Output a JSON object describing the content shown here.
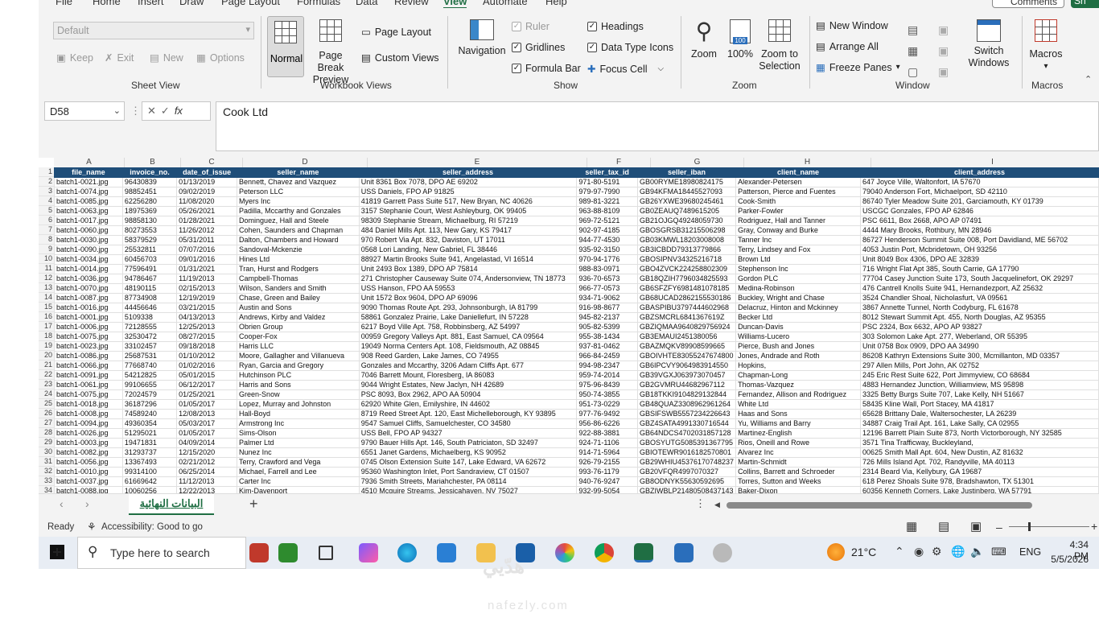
{
  "ribbon_tabs": [
    "File",
    "Home",
    "Insert",
    "Draw",
    "Page Layout",
    "Formulas",
    "Data",
    "Review",
    "View",
    "Automate",
    "Help"
  ],
  "active_tab": "View",
  "comments_label": "Comments",
  "share_label": "Sh",
  "sheet_view": {
    "select_value": "Default",
    "keep": "Keep",
    "exit": "Exit",
    "new": "New",
    "options": "Options",
    "group_label": "Sheet View"
  },
  "workbook_views": {
    "normal": "Normal",
    "page_break": "Page Break Preview",
    "page_layout": "Page Layout",
    "custom_views": "Custom Views",
    "group_label": "Workbook Views"
  },
  "show": {
    "navigation": "Navigation",
    "ruler": "Ruler",
    "gridlines": "Gridlines",
    "formula_bar": "Formula Bar",
    "headings": "Headings",
    "data_type_icons": "Data Type Icons",
    "focus_cell": "Focus Cell",
    "group_label": "Show"
  },
  "zoom": {
    "zoom": "Zoom",
    "hundred": "100%",
    "zoom_selection": "Zoom to Selection",
    "group_label": "Zoom"
  },
  "window": {
    "new_window": "New Window",
    "arrange_all": "Arrange All",
    "freeze_panes": "Freeze Panes",
    "switch_windows": "Switch Windows",
    "group_label": "Window"
  },
  "macros": {
    "macros": "Macros",
    "group_label": "Macros"
  },
  "formula_bar": {
    "name_box": "D58",
    "formula": "Cook Ltd",
    "fx": "fx"
  },
  "columns": [
    "A",
    "B",
    "C",
    "D",
    "E",
    "F",
    "G",
    "H",
    "I"
  ],
  "headers": [
    "file_name",
    "invoice_no.",
    "date_of_issue",
    "seller_name",
    "seller_address",
    "seller_tax_id",
    "seller_iban",
    "client_name",
    "client_address"
  ],
  "rows": [
    [
      "batch1-0021.jpg",
      "96430839",
      "01/13/2019",
      "Bennett, Chavez and Vazquez",
      "Unit 8361 Box 7078, DPO AE 69202",
      "971-80-5191",
      "GB00RYME18980824175",
      "Alexander-Petersen",
      "647 Joyce Ville, Waltonfort, IA 57670"
    ],
    [
      "batch1-0074.jpg",
      "98852451",
      "09/02/2019",
      "Peterson LLC",
      "USS Daniels, FPO AP 91825",
      "979-97-7990",
      "GB94KFMA18445527093",
      "Patterson, Pierce and Fuentes",
      "79040 Anderson Fort, Michaelport, SD 42110"
    ],
    [
      "batch1-0085.jpg",
      "62256280",
      "11/08/2020",
      "Myers Inc",
      "41819 Garrett Pass Suite 517, New Bryan, NC 40626",
      "989-81-3221",
      "GB26YXWE39680245461",
      "Cook-Smith",
      "86740 Tyler Meadow Suite 201, Garciamouth, KY 01739"
    ],
    [
      "batch1-0063.jpg",
      "18975369",
      "05/26/2021",
      "Padilla, Mccarthy and Gonzales",
      "3157 Stephanie Court, West Ashleyburg, OK 99405",
      "963-88-8109",
      "GB0ZEAUQ7489615205",
      "Parker-Fowler",
      "USCGC Gonzales, FPO AP 62846"
    ],
    [
      "batch1-0017.jpg",
      "98858130",
      "01/28/2021",
      "Dominguez, Hall and Steele",
      "98309 Stephanie Stream, Michaelburg, RI 57219",
      "969-72-5121",
      "GB21OJGQ49248059730",
      "Rodriguez, Hall and Tanner",
      "PSC 6611, Box 2668, APO AP 07491"
    ],
    [
      "batch1-0060.jpg",
      "80273553",
      "11/26/2012",
      "Cohen, Saunders and Chapman",
      "484 Daniel Mills Apt. 113, New Gary, KS 79417",
      "902-97-4185",
      "GBOSGRSB31215506298",
      "Gray, Conway and Burke",
      "4444 Mary Brooks, Rothbury, MN 28946"
    ],
    [
      "batch1-0030.jpg",
      "58379529",
      "05/31/2011",
      "Dalton, Chambers and Howard",
      "970 Robert Via Apt. 832, Daviston, UT 17011",
      "944-77-4530",
      "GB03KMWL18203008008",
      "Tanner Inc",
      "86727 Henderson Summit Suite 008, Port Davidland, ME 56702"
    ],
    [
      "batch1-0090.jpg",
      "25532811",
      "07/07/2016",
      "Sandoval-Mckenzie",
      "0568 Lori Landing, New Gabriel, FL 38446",
      "935-92-3150",
      "GB3ICBDD79313779866",
      "Terry, Lindsey and Fox",
      "4053 Justin Port, Mcbridetown, OH 93256"
    ],
    [
      "batch1-0034.jpg",
      "60456703",
      "09/01/2016",
      "Hines Ltd",
      "88927 Martin Brooks Suite 941, Angelastad, VI 16514",
      "970-94-1776",
      "GBOSIPNV34325216718",
      "Brown Ltd",
      "Unit 8049 Box 4306, DPO AE 32839"
    ],
    [
      "batch1-0014.jpg",
      "77596491",
      "01/31/2021",
      "Tran, Hurst and Rodgers",
      "Unit 2493 Box 1389, DPO AP 75814",
      "988-83-0971",
      "GBO4ZVCK224258802309",
      "Stephenson Inc",
      "716 Wright Flat Apt 385, South Carrie, GA 17790"
    ],
    [
      "batch1-0036.jpg",
      "94786467",
      "11/19/2013",
      "Campbell-Thomas",
      "271 Christopher Causeway Suite 074, Andersonview, TN 18773",
      "936-70-6573",
      "GB18QZIH7796034825593",
      "Gordon PLC",
      "77704 Casey Junction Suite 173, South Jacquelinefort, OK 29297"
    ],
    [
      "batch1-0070.jpg",
      "48190115",
      "02/15/2013",
      "Wilson, Sanders and Smith",
      "USS Hanson, FPO AA 59553",
      "966-77-0573",
      "GB6SFZFY6981481078185",
      "Medina-Robinson",
      "476 Cantrell Knolls Suite 941, Hernandezport, AZ 25632"
    ],
    [
      "batch1-0087.jpg",
      "87734908",
      "12/19/2019",
      "Chase, Green and Bailey",
      "Unit 1572 Box 9604, DPO AP 69096",
      "934-71-9062",
      "GB68UCAD2862155530186",
      "Buckley, Wright and Chase",
      "3524 Chandler Shoal, Nicholasfurt, VA 09561"
    ],
    [
      "batch1-0016.jpg",
      "44456646",
      "03/21/2015",
      "Austin and Sons",
      "9090 Thomas Route Apt. 293, Johnsonburgh, IA 81799",
      "916-98-8677",
      "GBASPIBU3797444602968",
      "Delacruz, Hinton and Mckinney",
      "3867 Annette Tunnel, North Codyburg, FL 61678"
    ],
    [
      "batch1-0001.jpg",
      "5109338",
      "04/13/2013",
      "Andrews, Kirby and Valdez",
      "58861 Gonzalez Prairie, Lake Daniellefurt, IN 57228",
      "945-82-2137",
      "GBZSMCRL6841367619Z",
      "Becker Ltd",
      "8012 Stewart Summit Apt. 455, North Douglas, AZ 95355"
    ],
    [
      "batch1-0006.jpg",
      "72128555",
      "12/25/2013",
      "Obrien Group",
      "6217 Boyd Ville Apt. 758, Robbinsberg, AZ 54997",
      "905-82-5399",
      "GBZIQMAA9640829756924",
      "Duncan-Davis",
      "PSC 2324, Box 6632, APO AP 93827"
    ],
    [
      "batch1-0075.jpg",
      "32530472",
      "08/27/2015",
      "Cooper-Fox",
      "00959 Gregory Valleys Apt. 881, East Samuel, CA 09564",
      "955-38-1434",
      "GB3EMAUI2451380056",
      "Williams-Lucero",
      "303 Solomon Lake Apt. 277, Weberland, OR 55395"
    ],
    [
      "batch1-0023.jpg",
      "33102457",
      "09/18/2018",
      "Harris LLC",
      "19049 Norma Centers Apt. 108, Fieldsmouth, AZ 08845",
      "937-81-0462",
      "GBAZMQKV89908599665",
      "Pierce, Bush and Jones",
      "Unit 0758 Box 0909, DPO AA 34990"
    ],
    [
      "batch1-0086.jpg",
      "25687531",
      "01/10/2012",
      "Moore, Gallagher and Villanueva",
      "908 Reed Garden, Lake James, CO 74955",
      "966-84-2459",
      "GBOIVHTE83055247674800",
      "Jones, Andrade and Roth",
      "86208 Kathryn Extensions Suite 300, Mcmillanton, MD 03357"
    ],
    [
      "batch1-0066.jpg",
      "77668740",
      "01/02/2016",
      "Ryan, Garcia and Gregory",
      "Gonzales and Mccarthy, 3206 Adam Cliffs Apt. 677",
      "994-98-2347",
      "GB6IPCVY9064983914550",
      "Hopkins,",
      "297 Allen Mills, Port John, AK 02752"
    ],
    [
      "batch1-0091.jpg",
      "54212825",
      "05/01/2015",
      "Hutchinson PLC",
      "7046 Barrett Mount, Floresberg, IA 86083",
      "959-74-2014",
      "GB39VGXJ063973070457",
      "Chapman-Long",
      "245 Eric Rest Suite 622, Port Jimmyview, CO 68684"
    ],
    [
      "batch1-0061.jpg",
      "99106655",
      "06/12/2017",
      "Harris and Sons",
      "9044 Wright Estates, New Jaclyn, NH 42689",
      "975-96-8439",
      "GB2GVMRU44682967112",
      "Thomas-Vazquez",
      "4883 Hernandez Junction, Williamview, MS 95898"
    ],
    [
      "batch1-0075.jpg",
      "72024579",
      "01/25/2021",
      "Green-Snow",
      "PSC 8093, Box 2962, APO AA 50904",
      "950-74-3855",
      "GB18TKKI9104829132844",
      "Fernandez, Allison and Rodriguez",
      "3325 Betty Burgs Suite 707, Lake Kelly, NH 51667"
    ],
    [
      "batch1-0018.jpg",
      "36187296",
      "01/05/2017",
      "Lopez, Murray and Johnston",
      "62920 White Glen, Emilyshire, IN 44602",
      "951-73-0229",
      "GB48QUAZ3308962961264",
      "White Ltd",
      "58435 Kline Wall, Port Stacey, MA 41817"
    ],
    [
      "batch1-0008.jpg",
      "74589240",
      "12/08/2013",
      "Hall-Boyd",
      "8719 Reed Street Apt. 120, East Michelleborough, KY 93895",
      "977-76-9492",
      "GBSIFSWB5557234226643",
      "Haas and Sons",
      "65628 Brittany Dale, Waltersochester, LA 26239"
    ],
    [
      "batch1-0094.jpg",
      "49360354",
      "05/03/2017",
      "Armstrong Inc",
      "9547 Samuel Cliffs, Samuelchester, CO 34580",
      "956-86-6226",
      "GBZ4SATA4991330716544",
      "Yu, Williams and Barry",
      "34887 Craig Trail Apt. 161, Lake Sally, CA 02955"
    ],
    [
      "batch1-0026.jpg",
      "51295021",
      "01/05/2017",
      "Sims-Olson",
      "USS Bell, FPO AP 94327",
      "922-88-3881",
      "GB64NDCS4702031857128",
      "Martinez-English",
      "12196 Barrett Plain Suite 873, North Victorborough, NY 32585"
    ],
    [
      "batch1-0003.jpg",
      "19471831",
      "04/09/2014",
      "Palmer Ltd",
      "9790 Bauer Hills Apt. 146, South Patriciaton, SD 32497",
      "924-71-1106",
      "GBOSYUTG5085391367795",
      "Rios, Oneill and Rowe",
      "3571 Tina Trafficway, Buckleyland,"
    ],
    [
      "batch1-0082.jpg",
      "31293737",
      "12/15/2020",
      "Nunez Inc",
      "6551 Janet Gardens, Michaelberg, KS 90952",
      "914-71-5964",
      "GBIOTEWR9016182570801",
      "Alvarez Inc",
      "00625 Smith Mall Apt. 604, New Dustin, AZ 81632"
    ],
    [
      "batch1-0056.jpg",
      "13367493",
      "02/21/2012",
      "Terry, Crawford and Vega",
      "0745 Olson Extension Suite 147, Lake Edward, VA 62672",
      "926-79-2155",
      "GB29WHIU45376170748237",
      "Martin-Schmidt",
      "726 Mills Island Apt. 702, Randyville, MA 40113"
    ],
    [
      "batch1-0010.jpg",
      "99314100",
      "06/25/2014",
      "Michael, Farrell and Lee",
      "95360 Washington Inlet, Port Sandraview, CT 01507",
      "993-76-1179",
      "GB20VFQR4997070327",
      "Collins, Barrett and Schroeder",
      "2314 Beard Via, Kellybury, GA 19687"
    ],
    [
      "batch1-0037.jpg",
      "61669642",
      "11/12/2013",
      "Carter Inc",
      "7936 Smith Streets, Mariahchester, PA 08114",
      "940-76-9247",
      "GB8ODNYK55630592695",
      "Torres, Sutton and Weeks",
      "618 Perez Shoals Suite 978, Bradshawton, TX 51301"
    ],
    [
      "batch1-0088.jpg",
      "10060256",
      "12/22/2013",
      "Kim-Davenport",
      "4510 Mcguire Streams, Jessicahaven, NV 75027",
      "932-99-5054",
      "GBZIWBLP21480508437143",
      "Baker-Dixon",
      "60356 Kenneth Corners, Lake Justinberg, WA 57791"
    ]
  ],
  "sheet_tab": "البيانات النهائية",
  "status": {
    "ready": "Ready",
    "accessibility": "Accessibility: Good to go"
  },
  "taskbar": {
    "search_placeholder": "Type here to search",
    "temperature": "21°C",
    "language": "ENG",
    "time": "4:34 PM",
    "date": "5/5/2026"
  },
  "watermark": {
    "arabic": "هدّيي",
    "latin": "nafezly.com"
  },
  "colors": {
    "header_fill": "#1f4e79",
    "excel_green": "#1f6e43",
    "taskbar": "#e8edf4"
  }
}
